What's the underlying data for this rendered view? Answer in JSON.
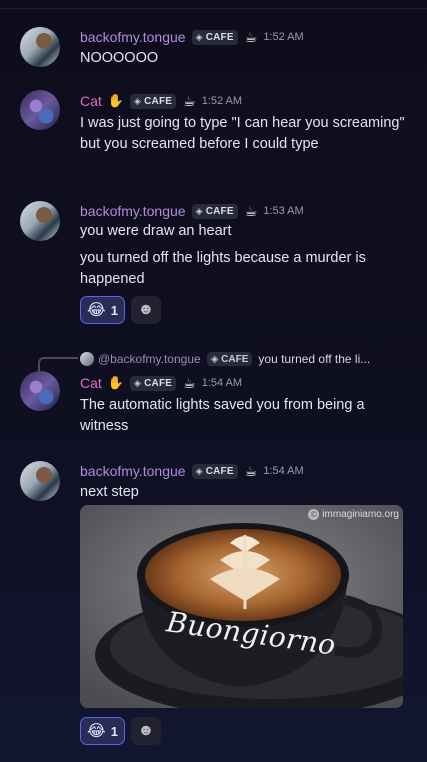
{
  "messages": [
    {
      "username": "backofmy.tongue",
      "tag": "CAFE",
      "time": "1:52 AM",
      "lines": [
        "NOOOOOO"
      ]
    },
    {
      "username": "Cat",
      "tag": "CAFE",
      "time": "1:52 AM",
      "lines": [
        "I was just going to type \"I can hear you screaming\" but you screamed before I could type"
      ]
    },
    {
      "username": "backofmy.tongue",
      "tag": "CAFE",
      "time": "1:53 AM",
      "lines": [
        "you were draw an heart",
        "you turned off the lights because a murder is happened"
      ],
      "reaction": {
        "emoji": "😂",
        "count": "1"
      }
    },
    {
      "reply": {
        "username": "@backofmy.tongue",
        "tag": "CAFE",
        "text": "you turned off the li..."
      },
      "username": "Cat",
      "tag": "CAFE",
      "time": "1:54 AM",
      "lines": [
        "The automatic lights saved you from being a witness"
      ]
    },
    {
      "username": "backofmy.tongue",
      "tag": "CAFE",
      "time": "1:54 AM",
      "lines": [
        "next step"
      ],
      "image": {
        "watermark": "immaginiamo.org",
        "cup_text": "Buongiorno"
      },
      "reaction": {
        "emoji": "😂",
        "count": "1"
      }
    }
  ],
  "colors": {
    "background": "#0f0f22",
    "username_purple": "#b28cd9",
    "username_pink": "#e66cc0",
    "reaction_border": "#5865f2"
  },
  "icons": {
    "hand": "hand-wave-icon",
    "tag": "diamond-icon",
    "cup": "coffee-cup-icon",
    "add_reaction": "smiley-add-icon"
  }
}
